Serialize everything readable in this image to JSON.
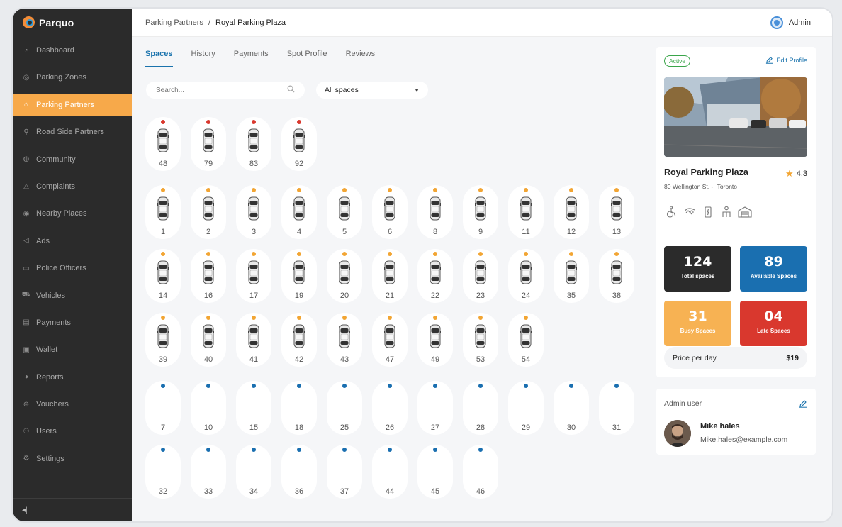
{
  "app": {
    "name": "Parquo"
  },
  "sidebar": {
    "items": [
      {
        "label": "Dashboard",
        "icon": "dashboard-icon",
        "active": false
      },
      {
        "label": "Parking Zones",
        "icon": "target-icon",
        "active": false
      },
      {
        "label": "Parking Partners",
        "icon": "partners-icon",
        "active": true
      },
      {
        "label": "Road Side Partners",
        "icon": "road-icon",
        "active": false
      },
      {
        "label": "Community",
        "icon": "globe-icon",
        "active": false
      },
      {
        "label": "Complaints",
        "icon": "warning-icon",
        "active": false
      },
      {
        "label": "Nearby Places",
        "icon": "pin-icon",
        "active": false
      },
      {
        "label": "Ads",
        "icon": "megaphone-icon",
        "active": false
      },
      {
        "label": "Police Officers",
        "icon": "badge-icon",
        "active": false
      },
      {
        "label": "Vehicles",
        "icon": "car-icon",
        "active": false
      },
      {
        "label": "Payments",
        "icon": "card-icon",
        "active": false
      },
      {
        "label": "Wallet",
        "icon": "wallet-icon",
        "active": false
      },
      {
        "label": "Reports",
        "icon": "chart-icon",
        "active": false
      },
      {
        "label": "Vouchers",
        "icon": "voucher-icon",
        "active": false
      },
      {
        "label": "Users",
        "icon": "users-icon",
        "active": false
      },
      {
        "label": "Settings",
        "icon": "gear-icon",
        "active": false
      }
    ],
    "collapse_glyph": "◂|"
  },
  "header": {
    "breadcrumb_parent": "Parking Partners",
    "breadcrumb_sep": "/",
    "breadcrumb_current": "Royal Parking Plaza",
    "user_label": "Admin"
  },
  "tabs": [
    {
      "label": "Spaces",
      "active": true
    },
    {
      "label": "History",
      "active": false
    },
    {
      "label": "Payments",
      "active": false
    },
    {
      "label": "Spot Profile",
      "active": false
    },
    {
      "label": "Reviews",
      "active": false
    }
  ],
  "search": {
    "placeholder": "Search..."
  },
  "filter": {
    "value": "All spaces"
  },
  "colors": {
    "late": "#d9382e",
    "busy": "#f2a533",
    "free": "#1a6fb0",
    "accent": "#f7a94a"
  },
  "spot_rows": [
    {
      "status": "late",
      "spots": [
        "48",
        "79",
        "83",
        "92"
      ]
    },
    {
      "status": "busy",
      "spots": [
        "1",
        "2",
        "3",
        "4",
        "5",
        "6",
        "8",
        "9",
        "11",
        "12",
        "13"
      ]
    },
    {
      "status": "busy",
      "spots": [
        "14",
        "16",
        "17",
        "19",
        "20",
        "21",
        "22",
        "23",
        "24",
        "35",
        "38"
      ]
    },
    {
      "status": "busy",
      "spots": [
        "39",
        "40",
        "41",
        "42",
        "43",
        "47",
        "49",
        "53",
        "54"
      ]
    },
    {
      "status": "free",
      "spots": [
        "7",
        "10",
        "15",
        "18",
        "25",
        "26",
        "27",
        "28",
        "29",
        "30",
        "31"
      ]
    },
    {
      "status": "free",
      "spots": [
        "32",
        "33",
        "34",
        "36",
        "37",
        "44",
        "45",
        "46"
      ]
    }
  ],
  "profile": {
    "status": "Active",
    "edit_label": "Edit Profile",
    "name": "Royal Parking Plaza",
    "rating": "4.3",
    "address": "80 Wellington St. -",
    "city": "Toronto",
    "amenities": [
      "wheelchair-icon",
      "car-wash-icon",
      "ev-charger-icon",
      "valet-icon",
      "garage-icon"
    ],
    "stats": [
      {
        "value": "124",
        "label": "Total spaces",
        "color": "#2b2b2b"
      },
      {
        "value": "89",
        "label": "Available Spaces",
        "color": "#1a6fb0"
      },
      {
        "value": "31",
        "label": "Busy Spaces",
        "color": "#f7b253"
      },
      {
        "value": "04",
        "label": "Late Spaces",
        "color": "#d9382e"
      }
    ],
    "price_label": "Price per day",
    "price_value": "$19"
  },
  "admin_user": {
    "title": "Admin user",
    "name": "Mike hales",
    "email": "Mike.hales@example.com"
  }
}
